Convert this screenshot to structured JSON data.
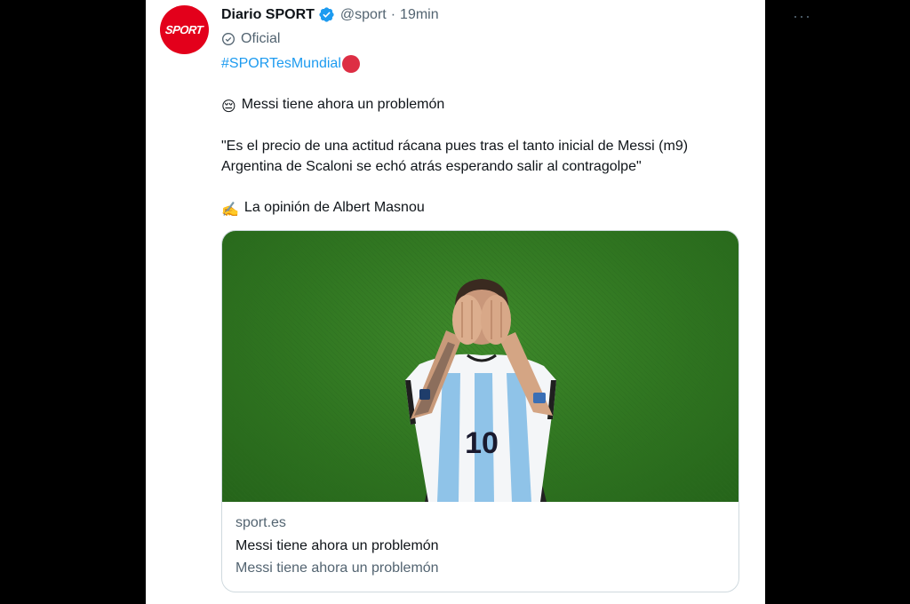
{
  "tweet": {
    "display_name": "Diario SPORT",
    "handle": "@sport",
    "separator": "·",
    "time": "19min",
    "more_label": "···",
    "badge_label": "Oficial",
    "avatar_text": "SPORT",
    "hashtag": "#SPORTesMundial",
    "line1_emoji": "😔",
    "line1": "Messi tiene ahora un problemón",
    "quote_line1": "\"Es el precio de una actitud rácana pues tras el tanto inicial de Messi (m9)",
    "quote_line2": "Argentina de Scaloni se echó atrás esperando salir al contragolpe\"",
    "line3_emoji": "✍️",
    "line3": "La opinión de Albert Masnou"
  },
  "card": {
    "domain": "sport.es",
    "title": "Messi tiene ahora un problemón",
    "description": "Messi tiene ahora un problemón",
    "jersey_number": "10"
  },
  "colors": {
    "link": "#1d9bf0",
    "brand_red": "#e3001b",
    "muted": "#536471",
    "text": "#0f1419",
    "verified": "#1d9bf0"
  },
  "icons": {
    "verified": "verified-badge-icon",
    "official": "official-check-icon",
    "more": "more-options-icon",
    "red_circle": "red-circle-emoji"
  }
}
